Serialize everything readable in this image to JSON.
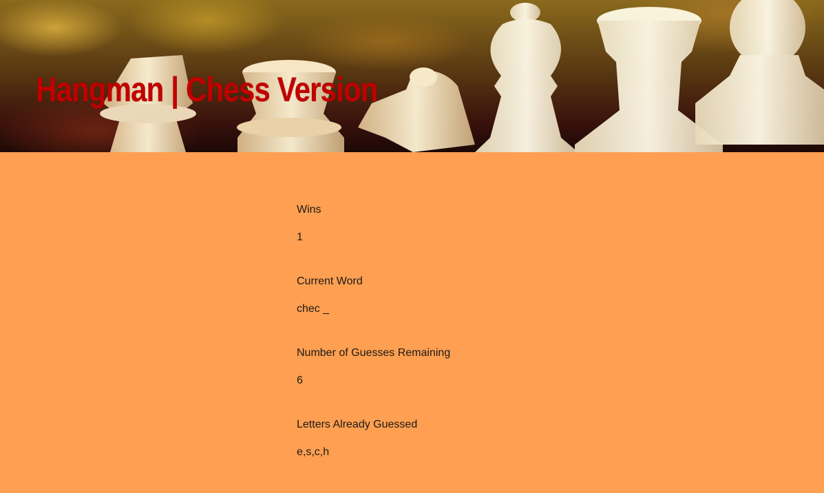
{
  "header": {
    "title": "Hangman | Chess Version"
  },
  "stats": {
    "wins_label": "Wins",
    "wins_value": "1",
    "current_word_label": "Current Word",
    "current_word_value": "chec _",
    "guesses_remaining_label": "Number of Guesses Remaining",
    "guesses_remaining_value": "6",
    "letters_guessed_label": "Letters Already Guessed",
    "letters_guessed_value": "e,s,c,h"
  },
  "colors": {
    "page_background": "#fe9f51",
    "title_color": "#c10000",
    "text_color": "#1d1a16"
  }
}
